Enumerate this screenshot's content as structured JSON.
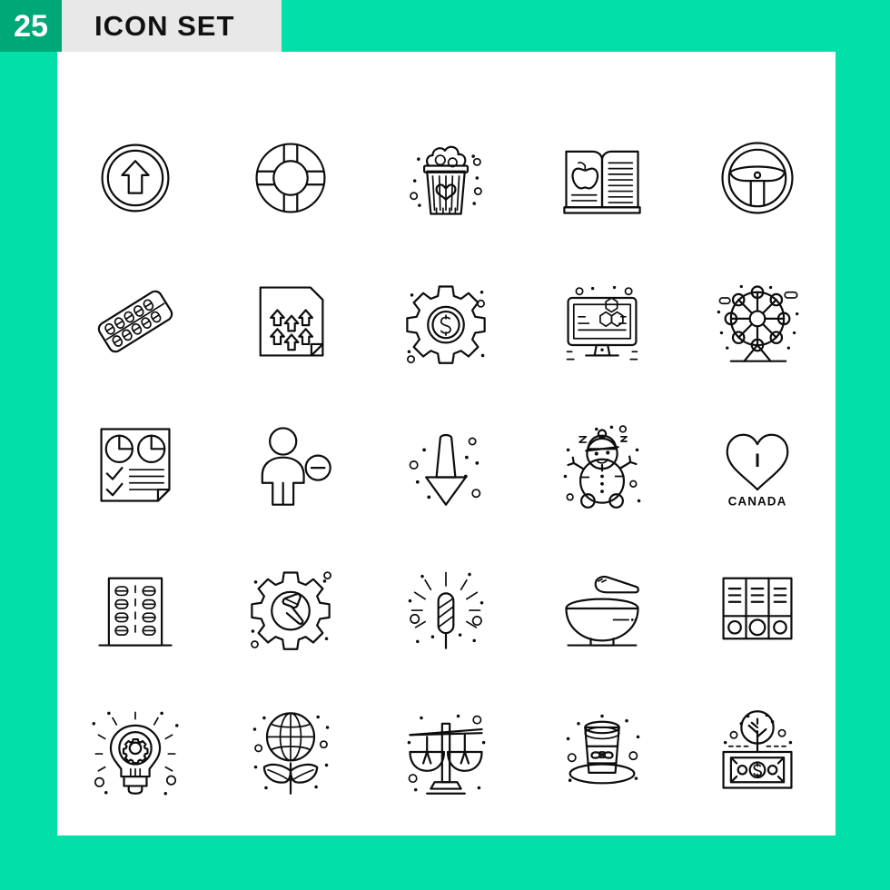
{
  "header": {
    "count": "25",
    "title": "ICON SET",
    "badge_color": "#00A878",
    "strip_color": "#E8E8E8"
  },
  "page": {
    "background_color": "#03DFA8",
    "card_color": "#FFFFFF",
    "stroke_color": "#0D0D0D"
  },
  "grid": {
    "columns": 5,
    "rows": 5,
    "total_icons": 25
  },
  "icons": [
    {
      "index": 1,
      "row": 1,
      "col": 1,
      "name": "upload-circle-icon",
      "label": "Upload arrow in circle"
    },
    {
      "index": 2,
      "row": 1,
      "col": 2,
      "name": "lifebuoy-icon",
      "label": "Lifebuoy"
    },
    {
      "index": 3,
      "row": 1,
      "col": 3,
      "name": "popcorn-heart-icon",
      "label": "Popcorn bucket with heart"
    },
    {
      "index": 4,
      "row": 1,
      "col": 4,
      "name": "open-book-apple-icon",
      "label": "Open book with apple"
    },
    {
      "index": 5,
      "row": 1,
      "col": 5,
      "name": "steering-wheel-icon",
      "label": "Steering wheel"
    },
    {
      "index": 6,
      "row": 2,
      "col": 1,
      "name": "pill-blister-pack-icon",
      "label": "Pill blister pack"
    },
    {
      "index": 7,
      "row": 2,
      "col": 2,
      "name": "document-upload-icon",
      "label": "Document with upload arrows"
    },
    {
      "index": 8,
      "row": 2,
      "col": 3,
      "name": "dollar-gear-icon",
      "label": "Gear with dollar sign"
    },
    {
      "index": 9,
      "row": 2,
      "col": 4,
      "name": "monitor-molecule-icon",
      "label": "Monitor with hexagon molecules"
    },
    {
      "index": 10,
      "row": 2,
      "col": 5,
      "name": "ferris-wheel-icon",
      "label": "Ferris wheel"
    },
    {
      "index": 11,
      "row": 3,
      "col": 1,
      "name": "report-chart-icon",
      "label": "Report page with pie charts"
    },
    {
      "index": 12,
      "row": 3,
      "col": 2,
      "name": "remove-user-icon",
      "label": "Remove user"
    },
    {
      "index": 13,
      "row": 3,
      "col": 3,
      "name": "download-arrow-snow-icon",
      "label": "Down arrow with snow"
    },
    {
      "index": 14,
      "row": 3,
      "col": 4,
      "name": "snowman-icon",
      "label": "Snowman"
    },
    {
      "index": 15,
      "row": 3,
      "col": 5,
      "name": "i-love-canada-icon",
      "label": "I love Canada",
      "caption_top": "I",
      "caption_bottom": "CANADA"
    },
    {
      "index": 16,
      "row": 4,
      "col": 1,
      "name": "building-icon",
      "label": "Building"
    },
    {
      "index": 17,
      "row": 4,
      "col": 2,
      "name": "gear-hammer-icon",
      "label": "Gear with hammer"
    },
    {
      "index": 18,
      "row": 4,
      "col": 3,
      "name": "sparkler-icon",
      "label": "Sparkler firecracker"
    },
    {
      "index": 19,
      "row": 4,
      "col": 4,
      "name": "bowl-spoon-icon",
      "label": "Bowl with spoon"
    },
    {
      "index": 20,
      "row": 4,
      "col": 5,
      "name": "archive-binders-icon",
      "label": "Archive binders"
    },
    {
      "index": 21,
      "row": 5,
      "col": 1,
      "name": "idea-gear-bulb-icon",
      "label": "Light bulb with gear"
    },
    {
      "index": 22,
      "row": 5,
      "col": 2,
      "name": "global-eco-plant-icon",
      "label": "Globe plant with leaves"
    },
    {
      "index": 23,
      "row": 5,
      "col": 3,
      "name": "balance-scales-icon",
      "label": "Balance scales"
    },
    {
      "index": 24,
      "row": 5,
      "col": 4,
      "name": "top-hat-icon",
      "label": "Top hat with bow"
    },
    {
      "index": 25,
      "row": 5,
      "col": 5,
      "name": "money-growth-icon",
      "label": "Banknote with growing tree"
    }
  ]
}
